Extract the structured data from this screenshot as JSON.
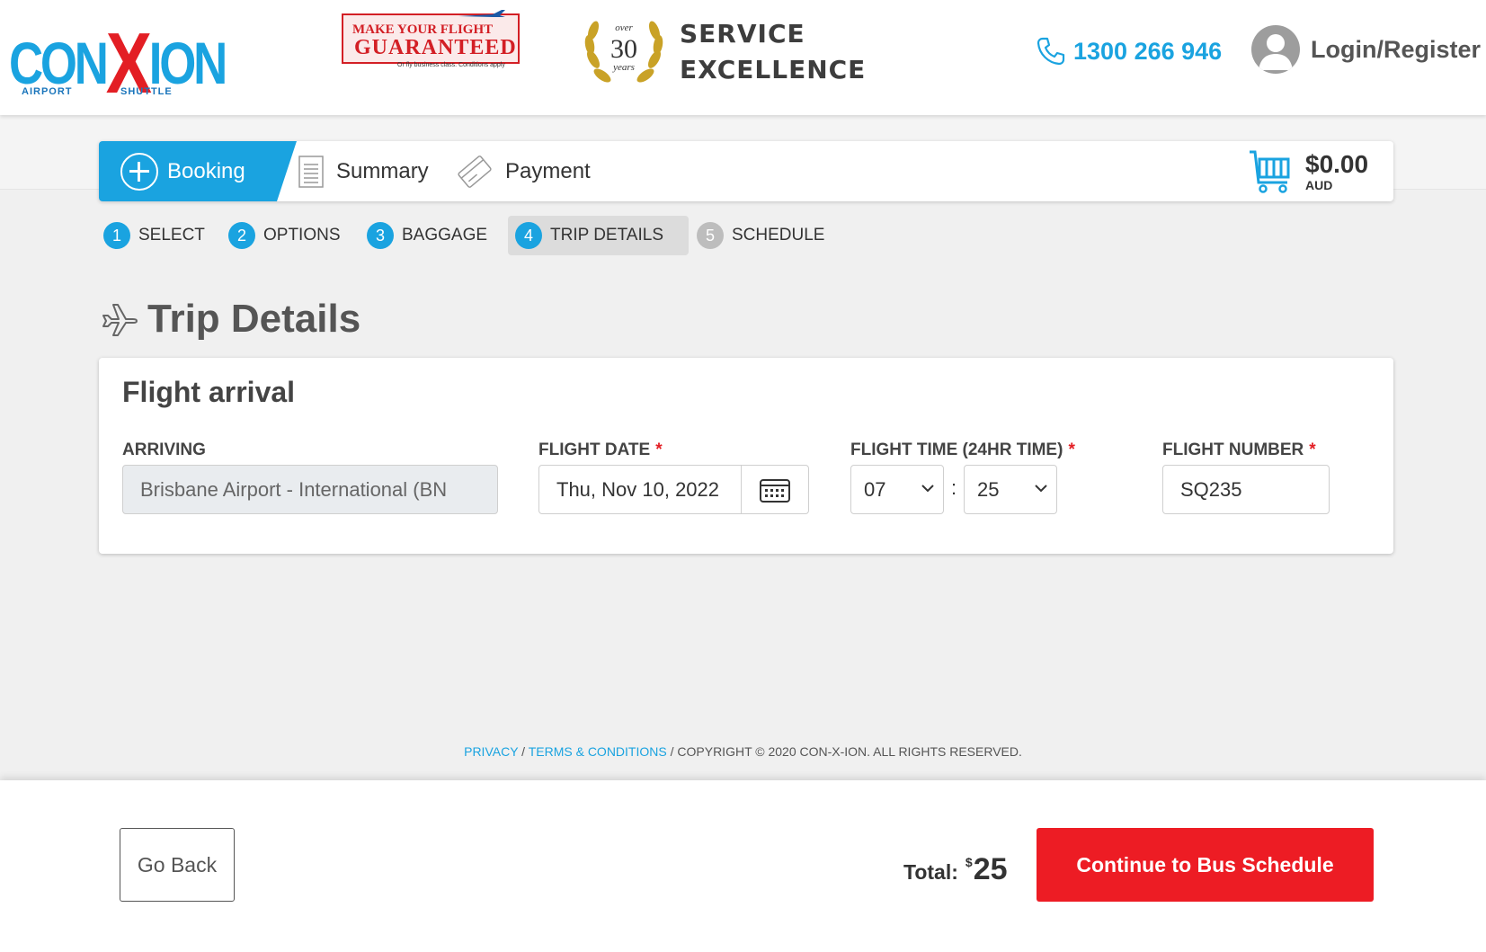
{
  "header": {
    "logo": {
      "text_main_left": "CON",
      "text_main_x": "X",
      "text_main_right": "ION",
      "sub_left": "AIRPORT",
      "sub_right": "SHUTTLE"
    },
    "guarantee": {
      "line1": "MAKE YOUR FLIGHT",
      "line2": "GUARANTEED",
      "line3": "Or fly business class. Conditions apply"
    },
    "award": {
      "over": "over",
      "years_num": "30",
      "years_word": "years",
      "line1": "SERVICE",
      "line2": "EXCELLENCE"
    },
    "phone": "1300 266 946",
    "login_label": "Login/Register"
  },
  "tabs": {
    "booking": "Booking",
    "summary": "Summary",
    "payment": "Payment",
    "cart_amount": "$0.00",
    "cart_currency": "AUD"
  },
  "steps": [
    {
      "num": "1",
      "label": "SELECT"
    },
    {
      "num": "2",
      "label": "OPTIONS"
    },
    {
      "num": "3",
      "label": "BAGGAGE"
    },
    {
      "num": "4",
      "label": "TRIP DETAILS"
    },
    {
      "num": "5",
      "label": "SCHEDULE"
    }
  ],
  "page_title": "Trip Details",
  "flight_arrival": {
    "title": "Flight arrival",
    "arriving_label": "ARRIVING",
    "arriving_value": "Brisbane Airport - International (BN",
    "date_label": "FLIGHT DATE",
    "date_value": "Thu, Nov 10, 2022",
    "time_label": "FLIGHT TIME (24HR TIME)",
    "time_hour": "07",
    "time_minute": "25",
    "number_label": "FLIGHT NUMBER",
    "number_value": "SQ235",
    "required_mark": "*"
  },
  "footer": {
    "privacy": "PRIVACY",
    "sep1": "/",
    "terms": "TERMS & CONDITIONS",
    "copyright": "/ COPYRIGHT © 2020 CON-X-ION. ALL RIGHTS RESERVED."
  },
  "bottom": {
    "go_back": "Go Back",
    "total_label": "Total:",
    "total_currency": "$",
    "total_amount": "25",
    "continue": "Continue to Bus Schedule"
  },
  "colors": {
    "brand_blue": "#1aa3e0",
    "brand_red": "#ed1c24"
  }
}
